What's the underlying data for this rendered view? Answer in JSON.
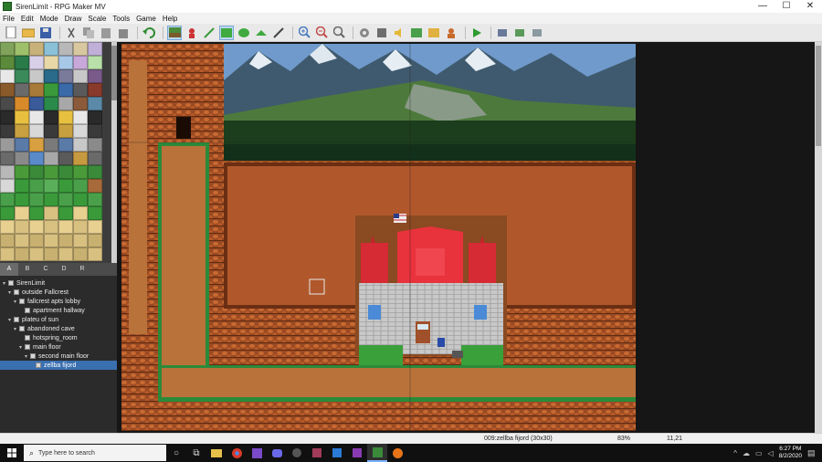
{
  "window": {
    "title": "SirenLimit - RPG Maker MV"
  },
  "menu": [
    "File",
    "Edit",
    "Mode",
    "Draw",
    "Scale",
    "Tools",
    "Game",
    "Help"
  ],
  "tabs": [
    "A",
    "B",
    "C",
    "D",
    "R"
  ],
  "tree": [
    {
      "label": "SirenLimit",
      "depth": 0,
      "expand": "▾"
    },
    {
      "label": "outside Fallcrest",
      "depth": 1,
      "expand": "▾"
    },
    {
      "label": "fallcrest apts lobby",
      "depth": 2,
      "expand": "▾"
    },
    {
      "label": "apartment hallway",
      "depth": 3,
      "expand": ""
    },
    {
      "label": "plateu of sun",
      "depth": 1,
      "expand": "▾"
    },
    {
      "label": "abandoned cave",
      "depth": 2,
      "expand": "▾"
    },
    {
      "label": "hotspring_room",
      "depth": 3,
      "expand": ""
    },
    {
      "label": "main floor",
      "depth": 3,
      "expand": "▾"
    },
    {
      "label": "second main floor",
      "depth": 4,
      "expand": "▾"
    },
    {
      "label": "zellba fijord",
      "depth": 5,
      "expand": "",
      "selected": true
    }
  ],
  "status": {
    "map": "009:zellba fijord (30x30)",
    "zoom": "83%",
    "coords": "11,21"
  },
  "taskbar": {
    "search_placeholder": "Type here to search",
    "time": "6:27 PM",
    "date": "8/2/2020"
  }
}
